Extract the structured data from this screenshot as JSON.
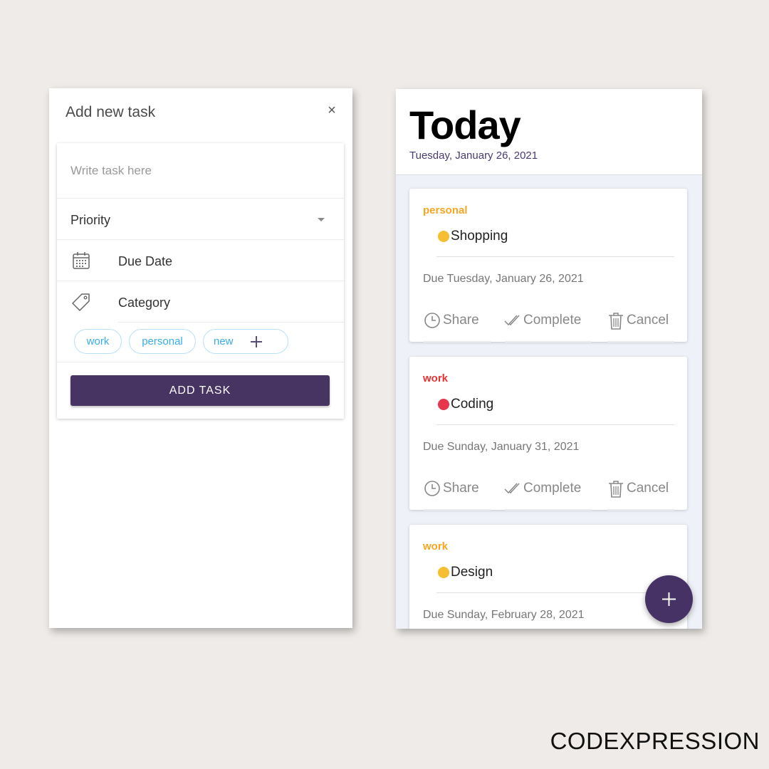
{
  "add_task_panel": {
    "title": "Add new task",
    "close_label": "×",
    "task_input": {
      "placeholder": "Write task here",
      "value": ""
    },
    "priority": {
      "label": "Priority"
    },
    "due_date": {
      "label": "Due Date"
    },
    "category": {
      "label": "Category"
    },
    "category_chips": [
      {
        "label": "work"
      },
      {
        "label": "personal"
      },
      {
        "label": "new"
      }
    ],
    "add_button_label": "ADD TASK"
  },
  "today_panel": {
    "title": "Today",
    "date": "Tuesday, January 26, 2021",
    "tasks": [
      {
        "category": "personal",
        "category_color": "#f5a623",
        "name": "Shopping",
        "dot_color": "#f6be31",
        "due": "Due Tuesday, January 26, 2021",
        "actions": {
          "share": "Share",
          "complete": "Complete",
          "cancel": "Cancel"
        }
      },
      {
        "category": "work",
        "category_color": "#e53333",
        "name": "Coding",
        "dot_color": "#e6364c",
        "due": "Due Sunday, January 31, 2021",
        "actions": {
          "share": "Share",
          "complete": "Complete",
          "cancel": "Cancel"
        }
      },
      {
        "category": "work",
        "category_color": "#f5a623",
        "name": "Design",
        "dot_color": "#f6be31",
        "due": "Due Sunday, February 28, 2021"
      }
    ],
    "fab_icon": "plus-icon"
  },
  "colors": {
    "accent": "#473463",
    "chip_text": "#39aee9",
    "background": "#eeebe8"
  },
  "brand": "CODEXPRESSION"
}
